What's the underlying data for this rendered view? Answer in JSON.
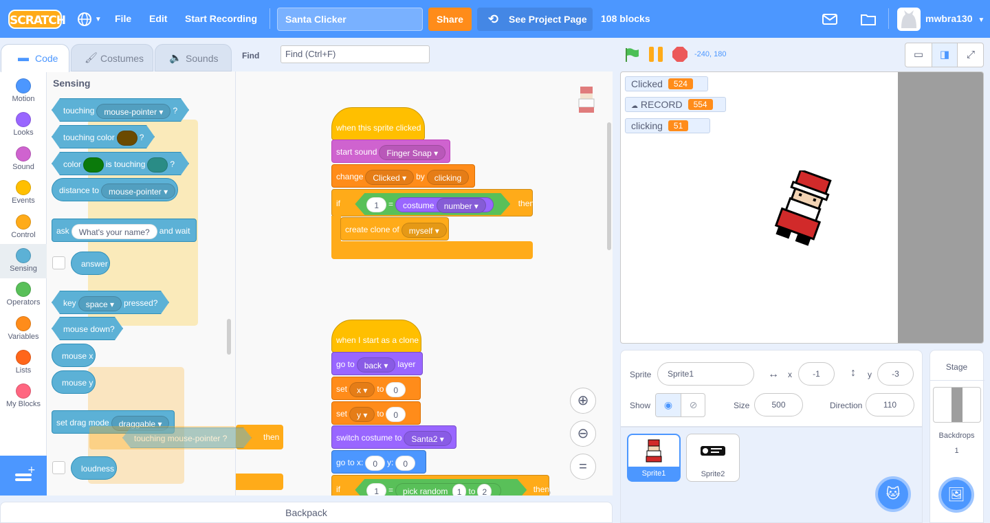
{
  "menubar": {
    "logo_text": "SCRATCH",
    "file": "File",
    "edit": "Edit",
    "start_recording": "Start Recording",
    "project_title": "Santa Clicker",
    "share": "Share",
    "see_project_page": "See Project Page",
    "block_count": "108 blocks",
    "username": "mwbra130"
  },
  "tabs": {
    "code": "Code",
    "costumes": "Costumes",
    "sounds": "Sounds"
  },
  "find": {
    "label": "Find",
    "placeholder": "Find (Ctrl+F)"
  },
  "categories": [
    {
      "label": "Motion",
      "color": "#4c97ff"
    },
    {
      "label": "Looks",
      "color": "#9966ff"
    },
    {
      "label": "Sound",
      "color": "#cf63cf"
    },
    {
      "label": "Events",
      "color": "#ffbf00"
    },
    {
      "label": "Control",
      "color": "#ffab19"
    },
    {
      "label": "Sensing",
      "color": "#5cb1d6"
    },
    {
      "label": "Operators",
      "color": "#59c059"
    },
    {
      "label": "Variables",
      "color": "#ff8c1a"
    },
    {
      "label": "Lists",
      "color": "#ff661a"
    },
    {
      "label": "My Blocks",
      "color": "#ff6680"
    }
  ],
  "palette": {
    "heading": "Sensing",
    "touching": "touching",
    "touching_menu": "mouse-pointer",
    "q": "?",
    "touching_color": "touching color",
    "color": "color",
    "is_touching": "is touching",
    "distance_to": "distance to",
    "distance_menu": "mouse-pointer",
    "ask": "ask",
    "ask_default": "What's your name?",
    "and_wait": "and wait",
    "answer": "answer",
    "key": "key",
    "key_menu": "space",
    "pressed": "pressed?",
    "mouse_down": "mouse down?",
    "mouse_x": "mouse x",
    "mouse_y": "mouse y",
    "set_drag_mode": "set drag mode",
    "drag_menu": "draggable",
    "loudness": "loudness"
  },
  "script1": {
    "hat": "when this sprite clicked",
    "start_sound": "start sound",
    "sound_menu": "Finger Snap",
    "change": "change",
    "var_menu": "Clicked",
    "by": "by",
    "by_val": "clicking",
    "if": "if",
    "eq_left": "1",
    "eq": "=",
    "costume": "costume",
    "costume_menu": "number",
    "then": "then",
    "create_clone": "create clone of",
    "clone_menu": "myself"
  },
  "script2": {
    "hat": "when I start as a clone",
    "go_to": "go to",
    "layer_menu": "back",
    "layer": "layer",
    "set": "set",
    "x_var": "x",
    "to": "to",
    "x_val": "0",
    "y_var": "y",
    "y_val": "0",
    "switch_costume": "switch costume to",
    "costume_menu": "Santa2",
    "goto_x": "go to x:",
    "gx": "0",
    "y_lbl": "y:",
    "gy": "0",
    "if": "if",
    "if_left": "1",
    "eq": "=",
    "pick_random": "pick random",
    "r1": "1",
    "r_to": "to",
    "r2": "2",
    "then": "then"
  },
  "ghost": {
    "then": "then",
    "if_touching": "touching",
    "touching_menu": "mouse-pointer",
    "q": "?"
  },
  "backpack": "Backpack",
  "stage_header": {
    "coords": "-240, 180"
  },
  "monitors": [
    {
      "label": "Clicked",
      "value": "524"
    },
    {
      "label": "RECORD",
      "value": "554"
    },
    {
      "label": "clicking",
      "value": "51"
    }
  ],
  "sprite_info": {
    "sprite_label": "Sprite",
    "sprite_name": "Sprite1",
    "x_label": "x",
    "x_value": "-1",
    "y_label": "y",
    "y_value": "-3",
    "show_label": "Show",
    "size_label": "Size",
    "size_value": "500",
    "direction_label": "Direction",
    "direction_value": "110"
  },
  "sprites": [
    {
      "name": "Sprite1"
    },
    {
      "name": "Sprite2"
    }
  ],
  "stage_panel": {
    "title": "Stage",
    "backdrops_label": "Backdrops",
    "backdrops_count": "1"
  }
}
